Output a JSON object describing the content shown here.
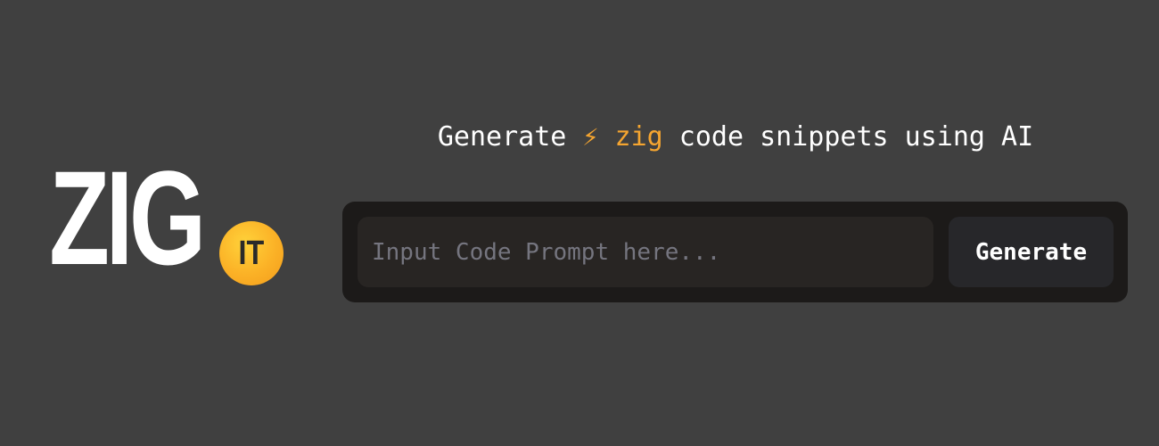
{
  "logo": {
    "word": "ZIG",
    "badge": "IT"
  },
  "tagline": {
    "prefix": "Generate ",
    "bolt": "⚡",
    "accent_word": "zig",
    "suffix": " code snippets using AI"
  },
  "form": {
    "input_value": "",
    "input_placeholder": "Input Code Prompt here...",
    "generate_label": "Generate"
  },
  "colors": {
    "background": "#404040",
    "accent": "#f5a530",
    "form_background": "#1c1a19",
    "input_background": "#282523",
    "button_background": "#27272a"
  }
}
